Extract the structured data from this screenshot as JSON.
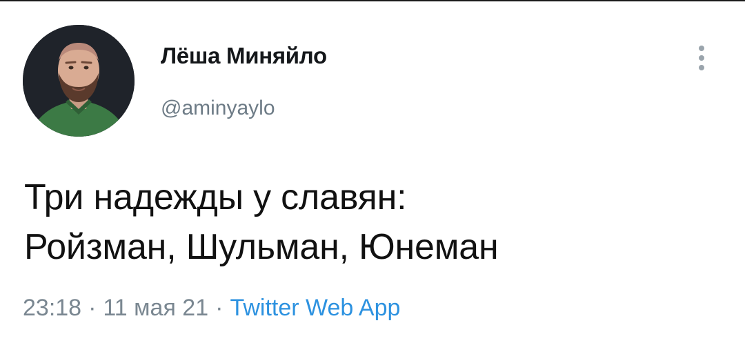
{
  "author": {
    "display_name": "Лёша Миняйло",
    "handle": "@aminyaylo"
  },
  "tweet": {
    "lines": [
      "Три надежды у славян:",
      "Ройзман, Шульман, Юнеман"
    ]
  },
  "meta": {
    "time": "23:18",
    "date": "11 мая 21",
    "separator": "·",
    "source": "Twitter Web App"
  },
  "colors": {
    "text": "#111111",
    "secondary_text": "#7a8791",
    "link": "#2d92e0",
    "background": "#ffffff"
  },
  "icons": {
    "more": "more-vertical-icon",
    "avatar": "avatar-photo"
  }
}
